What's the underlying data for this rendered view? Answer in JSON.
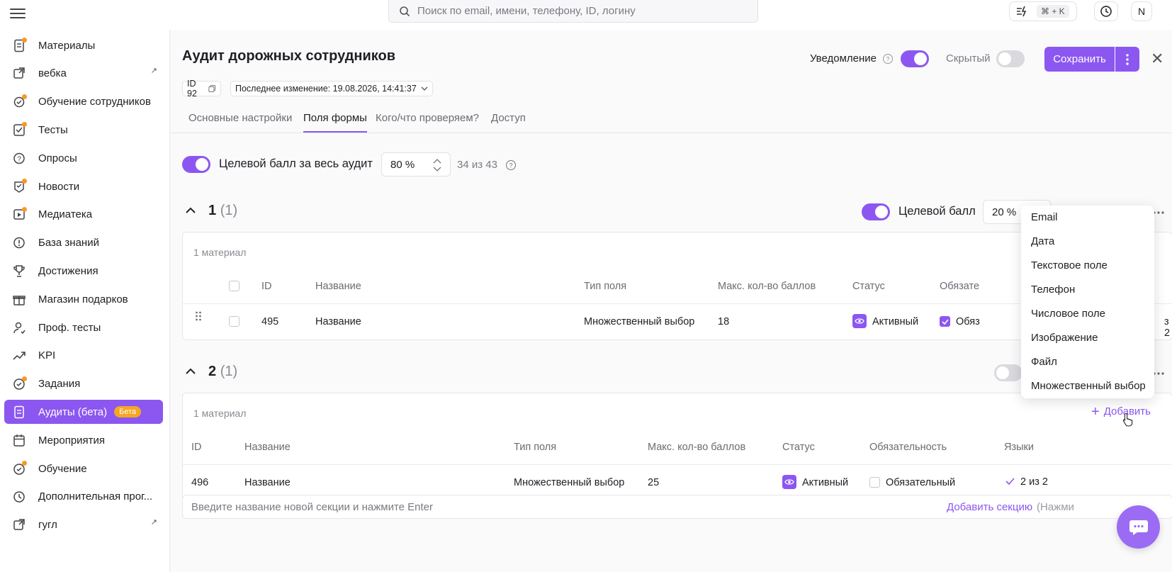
{
  "topbar": {
    "search_placeholder": "Поиск по email, имени, телефону, ID, логину",
    "hotkey": "⌘ + K",
    "user_initial": "N"
  },
  "sidebar": {
    "items": [
      {
        "label": "Материалы",
        "icon": "document-icon",
        "dot": true
      },
      {
        "label": "вебка",
        "icon": "external-link-icon",
        "ext": true
      },
      {
        "label": "Обучение сотрудников",
        "icon": "training-icon",
        "dot": true
      },
      {
        "label": "Тесты",
        "icon": "checklist-icon",
        "dot": true
      },
      {
        "label": "Опросы",
        "icon": "question-icon"
      },
      {
        "label": "Новости",
        "icon": "news-icon",
        "dot": true
      },
      {
        "label": "Медиатека",
        "icon": "media-icon",
        "dot": true
      },
      {
        "label": "База знаний",
        "icon": "info-icon"
      },
      {
        "label": "Достижения",
        "icon": "trophy-icon"
      },
      {
        "label": "Магазин подарков",
        "icon": "gift-icon"
      },
      {
        "label": "Проф. тесты",
        "icon": "person-icon"
      },
      {
        "label": "KPI",
        "icon": "trend-icon"
      },
      {
        "label": "Задания",
        "icon": "task-icon",
        "dot": true
      },
      {
        "label": "Аудиты (бета)",
        "icon": "audit-icon",
        "badge": "Бета",
        "active": true
      },
      {
        "label": "Мероприятия",
        "icon": "calendar-icon"
      },
      {
        "label": "Обучение",
        "icon": "learning-icon",
        "dot": true
      },
      {
        "label": "Дополнительная прог...",
        "icon": "program-icon"
      },
      {
        "label": "гугл",
        "icon": "external-link-icon",
        "ext": true
      }
    ]
  },
  "page": {
    "title": "Аудит дорожных сотрудников",
    "id_chip": "ID 92",
    "last_change": "Последнее изменение: 19.08.2026, 14:41:37",
    "notification_label": "Уведомление",
    "notification_on": true,
    "hidden_label": "Скрытый",
    "hidden_on": false,
    "save_label": "Сохранить"
  },
  "tabs": [
    "Основные настройки",
    "Поля формы",
    "Кого/что проверяем?",
    "Доступ"
  ],
  "active_tab": 1,
  "audit_score": {
    "label": "Целевой балл за весь аудит",
    "value": "80 %",
    "summary": "34 из 43"
  },
  "sections": [
    {
      "number": "1",
      "count": "(1)",
      "target_label": "Целевой балл",
      "target_value": "20 %",
      "caption": "1 материал",
      "headers": [
        "ID",
        "Название",
        "Тип поля",
        "Макс. кол-во баллов",
        "Статус",
        "Обязате"
      ],
      "row": {
        "id": "495",
        "name": "Название",
        "type": "Множественный выбор",
        "max": "18",
        "status": "Активный",
        "required": "Обяз",
        "langs": "з 2"
      }
    },
    {
      "number": "2",
      "count": "(1)",
      "caption": "1 материал",
      "add_label": "Добавить",
      "headers": [
        "ID",
        "Название",
        "Тип поля",
        "Макс. кол-во баллов",
        "Статус",
        "Обязательность",
        "Языки"
      ],
      "row": {
        "id": "496",
        "name": "Название",
        "type": "Множественный выбор",
        "max": "25",
        "status": "Активный",
        "required": "Обязательный",
        "langs": "2 из 2"
      }
    }
  ],
  "new_section": {
    "placeholder": "Введите название новой секции и нажмите Enter",
    "add_label": "Добавить секцию",
    "hint": "(Нажми"
  },
  "dropdown": [
    "Email",
    "Дата",
    "Текстовое поле",
    "Телефон",
    "Числовое поле",
    "Изображение",
    "Файл",
    "Множественный выбор"
  ],
  "colors": {
    "accent": "#8c57f0",
    "badge": "#f5a623"
  }
}
